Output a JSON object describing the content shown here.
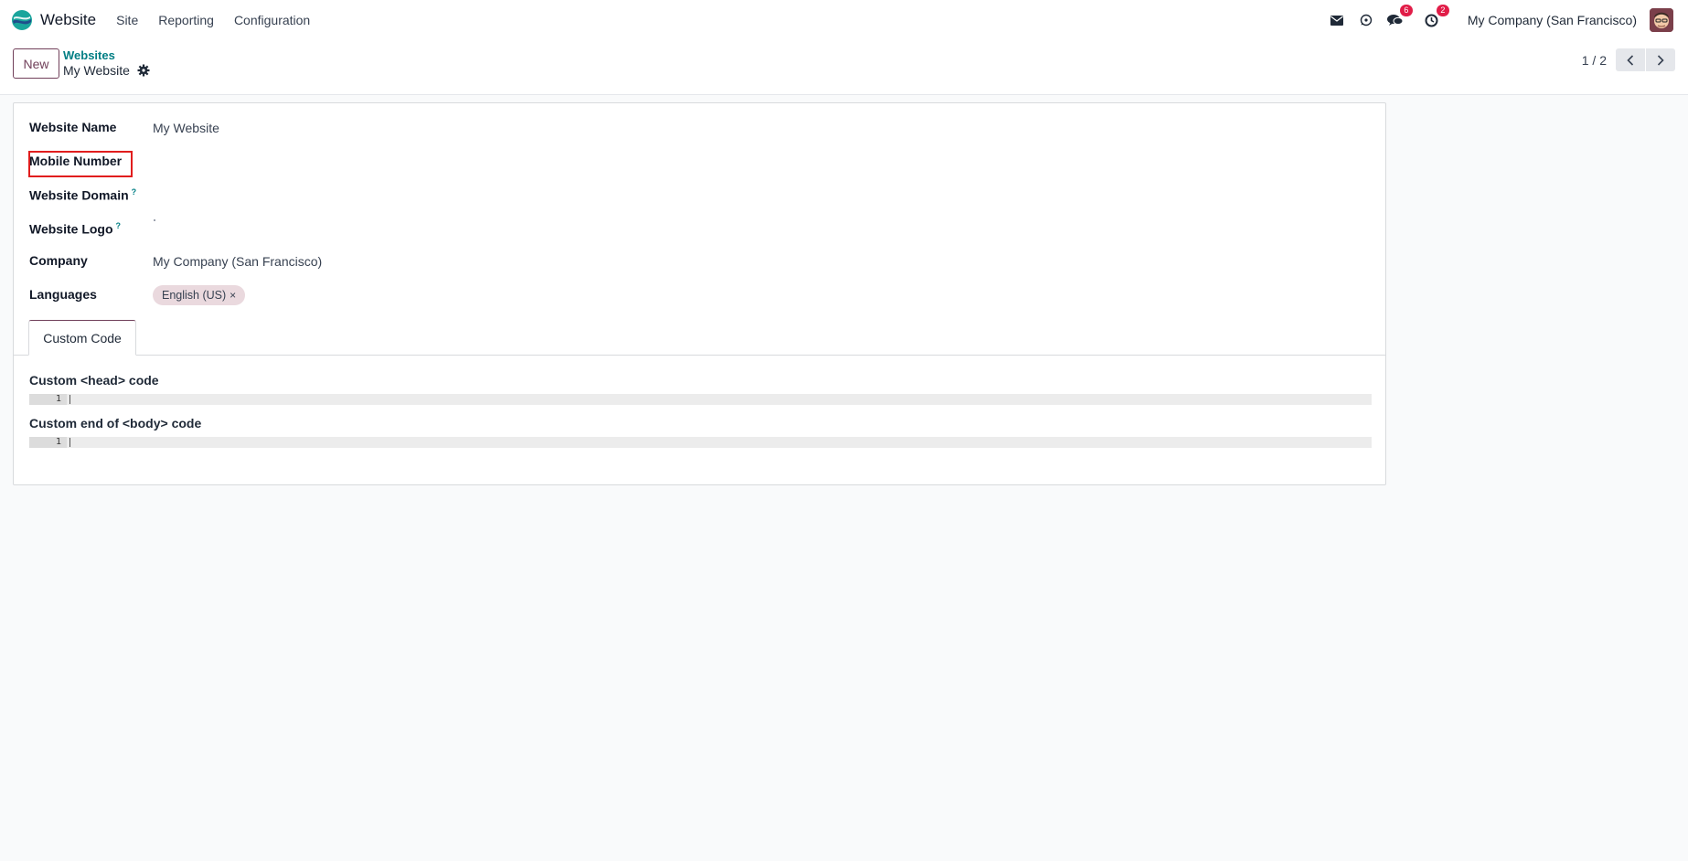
{
  "navbar": {
    "app_name": "Website",
    "menu": [
      "Site",
      "Reporting",
      "Configuration"
    ],
    "messages_badge": "6",
    "activities_badge": "2",
    "company": "My Company (San Francisco)"
  },
  "control_panel": {
    "new_label": "New",
    "breadcrumb_parent": "Websites",
    "breadcrumb_current": "My Website",
    "pager": "1 / 2"
  },
  "form": {
    "website_name_label": "Website Name",
    "website_name_value": "My Website",
    "mobile_number_label": "Mobile Number",
    "website_domain_label": "Website Domain",
    "website_logo_label": "Website Logo",
    "help_mark": "?",
    "company_label": "Company",
    "company_value": "My Company (San Francisco)",
    "languages_label": "Languages",
    "language_tag": "English (US)",
    "tag_remove": "×"
  },
  "notebook": {
    "tab_label": "Custom Code",
    "head_code_label": "Custom <head> code",
    "body_code_label": "Custom end of <body> code",
    "line_number": "1"
  },
  "colors": {
    "brand": "#71405a",
    "link": "#017e84",
    "badge": "#e11d48",
    "highlight_box": "#e11d1d"
  }
}
